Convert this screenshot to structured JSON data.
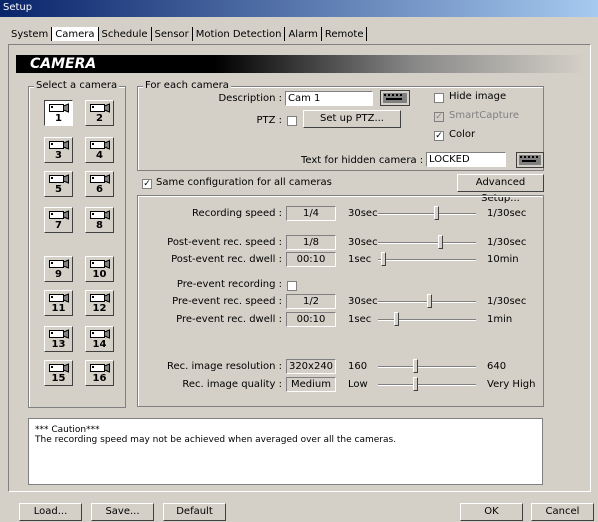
{
  "window": {
    "title": "Setup"
  },
  "tabs": [
    "System",
    "Camera",
    "Schedule",
    "Sensor",
    "Motion Detection",
    "Alarm",
    "Remote"
  ],
  "banner": "CAMERA",
  "cameras": {
    "label": "Select a camera",
    "items": [
      "1",
      "2",
      "3",
      "4",
      "5",
      "6",
      "7",
      "8",
      "9",
      "10",
      "11",
      "12",
      "13",
      "14",
      "15",
      "16"
    ]
  },
  "each_camera": {
    "label": "For each camera",
    "description_label": "Description :",
    "description_value": "Cam 1",
    "ptz_label": "PTZ :",
    "setup_ptz": "Set up PTZ...",
    "hide_image": "Hide image",
    "smart_capture": "SmartCapture",
    "color": "Color"
  },
  "hidden_text": {
    "label": "Text for hidden camera :",
    "value": "LOCKED"
  },
  "same_config": "Same configuration for all cameras",
  "advanced": "Advanced Setup...",
  "settings": {
    "recording_speed": {
      "label": "Recording speed :",
      "value": "1/4",
      "min": "30sec",
      "max": "1/30sec",
      "level": 0.6
    },
    "post_speed": {
      "label": "Post-event rec. speed :",
      "value": "1/8",
      "min": "30sec",
      "max": "1/30sec",
      "level": 0.65
    },
    "post_dwell": {
      "label": "Post-event rec. dwell :",
      "value": "00:10",
      "min": "1sec",
      "max": "10min",
      "level": 0.03
    },
    "pre_recording": {
      "label": "Pre-event recording :"
    },
    "pre_speed": {
      "label": "Pre-event rec. speed :",
      "value": "1/2",
      "min": "30sec",
      "max": "1/30sec",
      "level": 0.53
    },
    "pre_dwell": {
      "label": "Pre-event rec. dwell :",
      "value": "00:10",
      "min": "1sec",
      "max": "1min",
      "level": 0.17
    },
    "resolution": {
      "label": "Rec. image resolution :",
      "value": "320x240",
      "min": "160",
      "max": "640",
      "level": 0.38
    },
    "quality": {
      "label": "Rec. image quality :",
      "value": "Medium",
      "min": "Low",
      "max": "Very High",
      "level": 0.38
    }
  },
  "caution": {
    "title": "*** Caution***",
    "text": "The recording speed may not be achieved when averaged over all the cameras."
  },
  "buttons": {
    "load": "Load...",
    "save": "Save...",
    "default": "Default",
    "ok": "OK",
    "cancel": "Cancel"
  }
}
